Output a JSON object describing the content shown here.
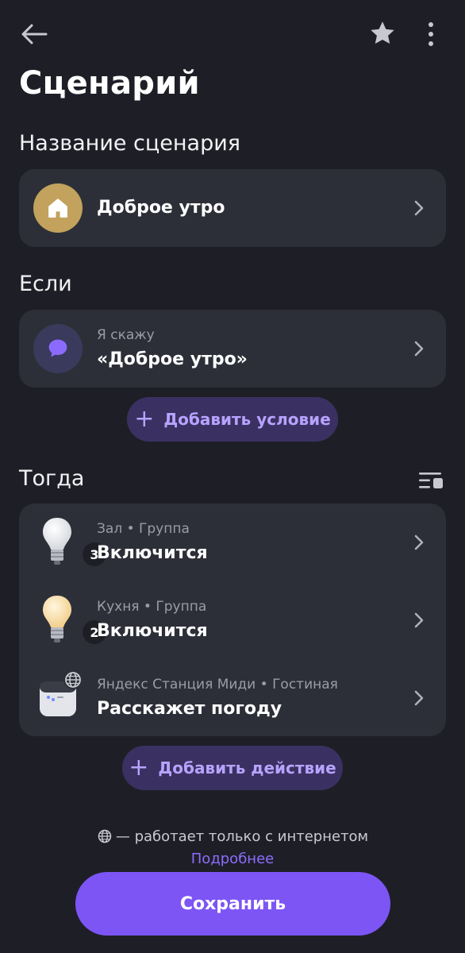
{
  "header": {
    "back_icon": "arrow-left-icon",
    "favorite_icon": "star-icon",
    "more_icon": "more-vertical-icon"
  },
  "page": {
    "title": "Сценарий"
  },
  "name_section": {
    "title": "Название сценария",
    "scenario_name": "Доброе утро",
    "icon": "house-icon",
    "icon_bg": "#c2a25c"
  },
  "if_section": {
    "title": "Если",
    "condition_sub": "Я скажу",
    "condition_main": "«Доброе утро»",
    "icon": "chat-bubble-icon",
    "add_condition_label": "Добавить условие"
  },
  "then_section": {
    "title": "Тогда",
    "sort_icon": "list-settings-icon",
    "actions": [
      {
        "sub": "Зал • Группа",
        "main": "Включится",
        "icon": "lightbulb-cool-icon",
        "count": "3"
      },
      {
        "sub": "Кухня • Группа",
        "main": "Включится",
        "icon": "lightbulb-warm-icon",
        "count": "2"
      },
      {
        "sub": "Яндекс Станция Миди  •  Гостиная",
        "main": "Расскажет погоду",
        "icon": "smart-speaker-icon",
        "badge_icon": "globe-icon"
      }
    ],
    "add_action_label": "Добавить действие"
  },
  "footer": {
    "note": "— работает только с интернетом",
    "note_icon": "globe-icon",
    "more_link": "Подробнее",
    "save_label": "Сохранить"
  },
  "colors": {
    "background": "#1e1f26",
    "card": "#2d2f38",
    "accent": "#7d55f5",
    "accent_text": "#b7a3ff",
    "pill_bg": "#3a3162"
  }
}
